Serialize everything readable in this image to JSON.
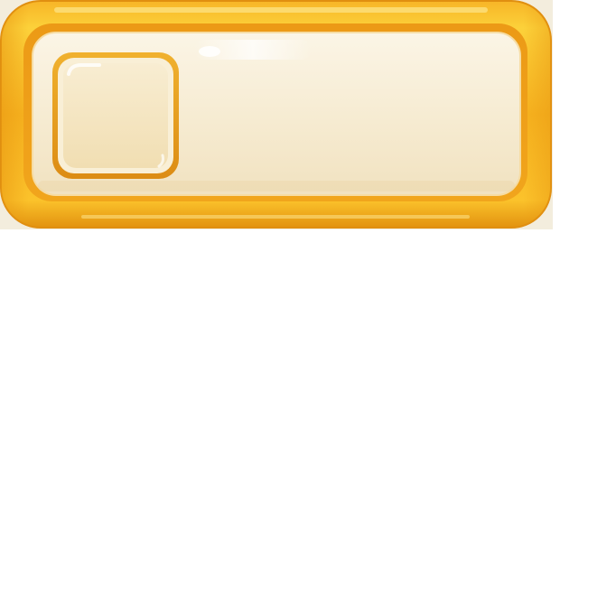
{
  "panel": {
    "kind": "empty item slot panel",
    "slot_count": 1
  },
  "colors": {
    "frame_outer": "#f0a81c",
    "frame_mid": "#fbc22b",
    "frame_shadow": "#d98a12",
    "panel_fill": "#f5ead0",
    "panel_fill_light": "#f9f2e1",
    "slot_fill": "#f4e3bc",
    "slot_rim": "#e9a322",
    "background": "#ffffff"
  },
  "icons": {
    "slot": "empty-slot-icon"
  }
}
